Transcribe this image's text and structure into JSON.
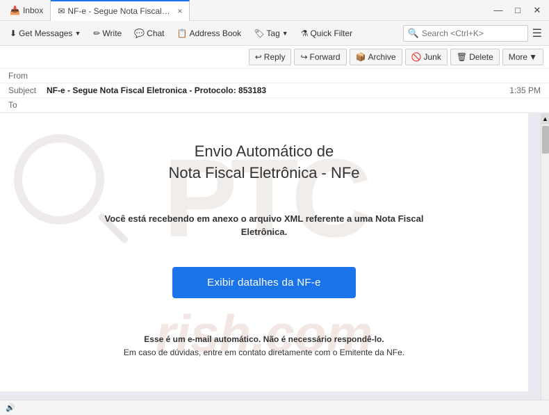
{
  "titlebar": {
    "inbox_tab": "Inbox",
    "email_tab": "NF-e - Segue Nota Fiscal El...",
    "close_tab_label": "×",
    "controls": {
      "minimize": "—",
      "maximize": "□",
      "close": "✕"
    }
  },
  "toolbar": {
    "get_messages": "Get Messages",
    "write": "Write",
    "chat": "Chat",
    "address_book": "Address Book",
    "tag": "Tag",
    "quick_filter": "Quick Filter",
    "search_placeholder": "Search <Ctrl+K>"
  },
  "action_bar": {
    "reply": "Reply",
    "forward": "Forward",
    "archive": "Archive",
    "junk": "Junk",
    "delete": "Delete",
    "more": "More"
  },
  "email_header": {
    "from_label": "From",
    "from_value": "",
    "subject_label": "Subject",
    "subject_value": "NF-e - Segue Nota Fiscal Eletronica - Protocolo: 853183",
    "to_label": "To",
    "to_value": "",
    "timestamp": "1:35 PM"
  },
  "email_body": {
    "title_line1": "Envio Automático de",
    "title_line2": "Nota Fiscal Eletrônica - NFe",
    "body_text": "Você está recebendo em anexo o arquivo XML referente a uma Nota Fiscal Eletrônica.",
    "cta_button": "Exibir datalhes da NF-e",
    "footer_line1": "Esse é um e-mail automático. Não é necessário respondê-lo.",
    "footer_line2": "Em caso de dúvidas, entre em contato diretamente com o Emitente da NFe."
  },
  "watermark": {
    "ptc": "PTC",
    "rish": "rish.com"
  },
  "status_bar": {
    "icon": "🔊"
  }
}
